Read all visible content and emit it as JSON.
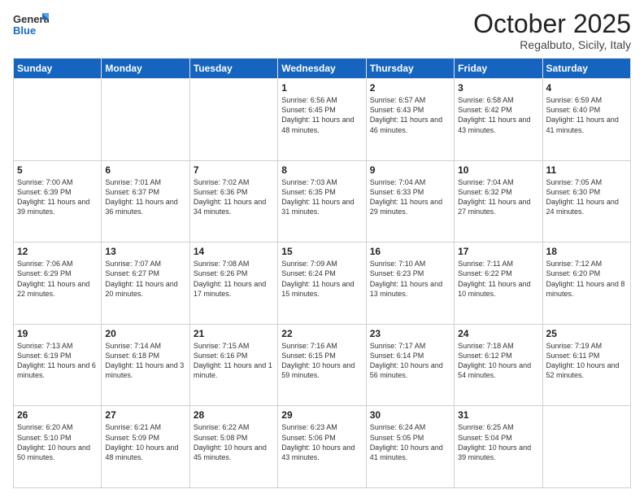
{
  "logo": {
    "general": "General",
    "blue": "Blue"
  },
  "header": {
    "month": "October 2025",
    "location": "Regalbuto, Sicily, Italy"
  },
  "days_of_week": [
    "Sunday",
    "Monday",
    "Tuesday",
    "Wednesday",
    "Thursday",
    "Friday",
    "Saturday"
  ],
  "weeks": [
    [
      {
        "day": "",
        "info": ""
      },
      {
        "day": "",
        "info": ""
      },
      {
        "day": "",
        "info": ""
      },
      {
        "day": "1",
        "info": "Sunrise: 6:56 AM\nSunset: 6:45 PM\nDaylight: 11 hours\nand 48 minutes."
      },
      {
        "day": "2",
        "info": "Sunrise: 6:57 AM\nSunset: 6:43 PM\nDaylight: 11 hours\nand 46 minutes."
      },
      {
        "day": "3",
        "info": "Sunrise: 6:58 AM\nSunset: 6:42 PM\nDaylight: 11 hours\nand 43 minutes."
      },
      {
        "day": "4",
        "info": "Sunrise: 6:59 AM\nSunset: 6:40 PM\nDaylight: 11 hours\nand 41 minutes."
      }
    ],
    [
      {
        "day": "5",
        "info": "Sunrise: 7:00 AM\nSunset: 6:39 PM\nDaylight: 11 hours\nand 39 minutes."
      },
      {
        "day": "6",
        "info": "Sunrise: 7:01 AM\nSunset: 6:37 PM\nDaylight: 11 hours\nand 36 minutes."
      },
      {
        "day": "7",
        "info": "Sunrise: 7:02 AM\nSunset: 6:36 PM\nDaylight: 11 hours\nand 34 minutes."
      },
      {
        "day": "8",
        "info": "Sunrise: 7:03 AM\nSunset: 6:35 PM\nDaylight: 11 hours\nand 31 minutes."
      },
      {
        "day": "9",
        "info": "Sunrise: 7:04 AM\nSunset: 6:33 PM\nDaylight: 11 hours\nand 29 minutes."
      },
      {
        "day": "10",
        "info": "Sunrise: 7:04 AM\nSunset: 6:32 PM\nDaylight: 11 hours\nand 27 minutes."
      },
      {
        "day": "11",
        "info": "Sunrise: 7:05 AM\nSunset: 6:30 PM\nDaylight: 11 hours\nand 24 minutes."
      }
    ],
    [
      {
        "day": "12",
        "info": "Sunrise: 7:06 AM\nSunset: 6:29 PM\nDaylight: 11 hours\nand 22 minutes."
      },
      {
        "day": "13",
        "info": "Sunrise: 7:07 AM\nSunset: 6:27 PM\nDaylight: 11 hours\nand 20 minutes."
      },
      {
        "day": "14",
        "info": "Sunrise: 7:08 AM\nSunset: 6:26 PM\nDaylight: 11 hours\nand 17 minutes."
      },
      {
        "day": "15",
        "info": "Sunrise: 7:09 AM\nSunset: 6:24 PM\nDaylight: 11 hours\nand 15 minutes."
      },
      {
        "day": "16",
        "info": "Sunrise: 7:10 AM\nSunset: 6:23 PM\nDaylight: 11 hours\nand 13 minutes."
      },
      {
        "day": "17",
        "info": "Sunrise: 7:11 AM\nSunset: 6:22 PM\nDaylight: 11 hours\nand 10 minutes."
      },
      {
        "day": "18",
        "info": "Sunrise: 7:12 AM\nSunset: 6:20 PM\nDaylight: 11 hours\nand 8 minutes."
      }
    ],
    [
      {
        "day": "19",
        "info": "Sunrise: 7:13 AM\nSunset: 6:19 PM\nDaylight: 11 hours\nand 6 minutes."
      },
      {
        "day": "20",
        "info": "Sunrise: 7:14 AM\nSunset: 6:18 PM\nDaylight: 11 hours\nand 3 minutes."
      },
      {
        "day": "21",
        "info": "Sunrise: 7:15 AM\nSunset: 6:16 PM\nDaylight: 11 hours\nand 1 minute."
      },
      {
        "day": "22",
        "info": "Sunrise: 7:16 AM\nSunset: 6:15 PM\nDaylight: 10 hours\nand 59 minutes."
      },
      {
        "day": "23",
        "info": "Sunrise: 7:17 AM\nSunset: 6:14 PM\nDaylight: 10 hours\nand 56 minutes."
      },
      {
        "day": "24",
        "info": "Sunrise: 7:18 AM\nSunset: 6:12 PM\nDaylight: 10 hours\nand 54 minutes."
      },
      {
        "day": "25",
        "info": "Sunrise: 7:19 AM\nSunset: 6:11 PM\nDaylight: 10 hours\nand 52 minutes."
      }
    ],
    [
      {
        "day": "26",
        "info": "Sunrise: 6:20 AM\nSunset: 5:10 PM\nDaylight: 10 hours\nand 50 minutes."
      },
      {
        "day": "27",
        "info": "Sunrise: 6:21 AM\nSunset: 5:09 PM\nDaylight: 10 hours\nand 48 minutes."
      },
      {
        "day": "28",
        "info": "Sunrise: 6:22 AM\nSunset: 5:08 PM\nDaylight: 10 hours\nand 45 minutes."
      },
      {
        "day": "29",
        "info": "Sunrise: 6:23 AM\nSunset: 5:06 PM\nDaylight: 10 hours\nand 43 minutes."
      },
      {
        "day": "30",
        "info": "Sunrise: 6:24 AM\nSunset: 5:05 PM\nDaylight: 10 hours\nand 41 minutes."
      },
      {
        "day": "31",
        "info": "Sunrise: 6:25 AM\nSunset: 5:04 PM\nDaylight: 10 hours\nand 39 minutes."
      },
      {
        "day": "",
        "info": ""
      }
    ]
  ]
}
